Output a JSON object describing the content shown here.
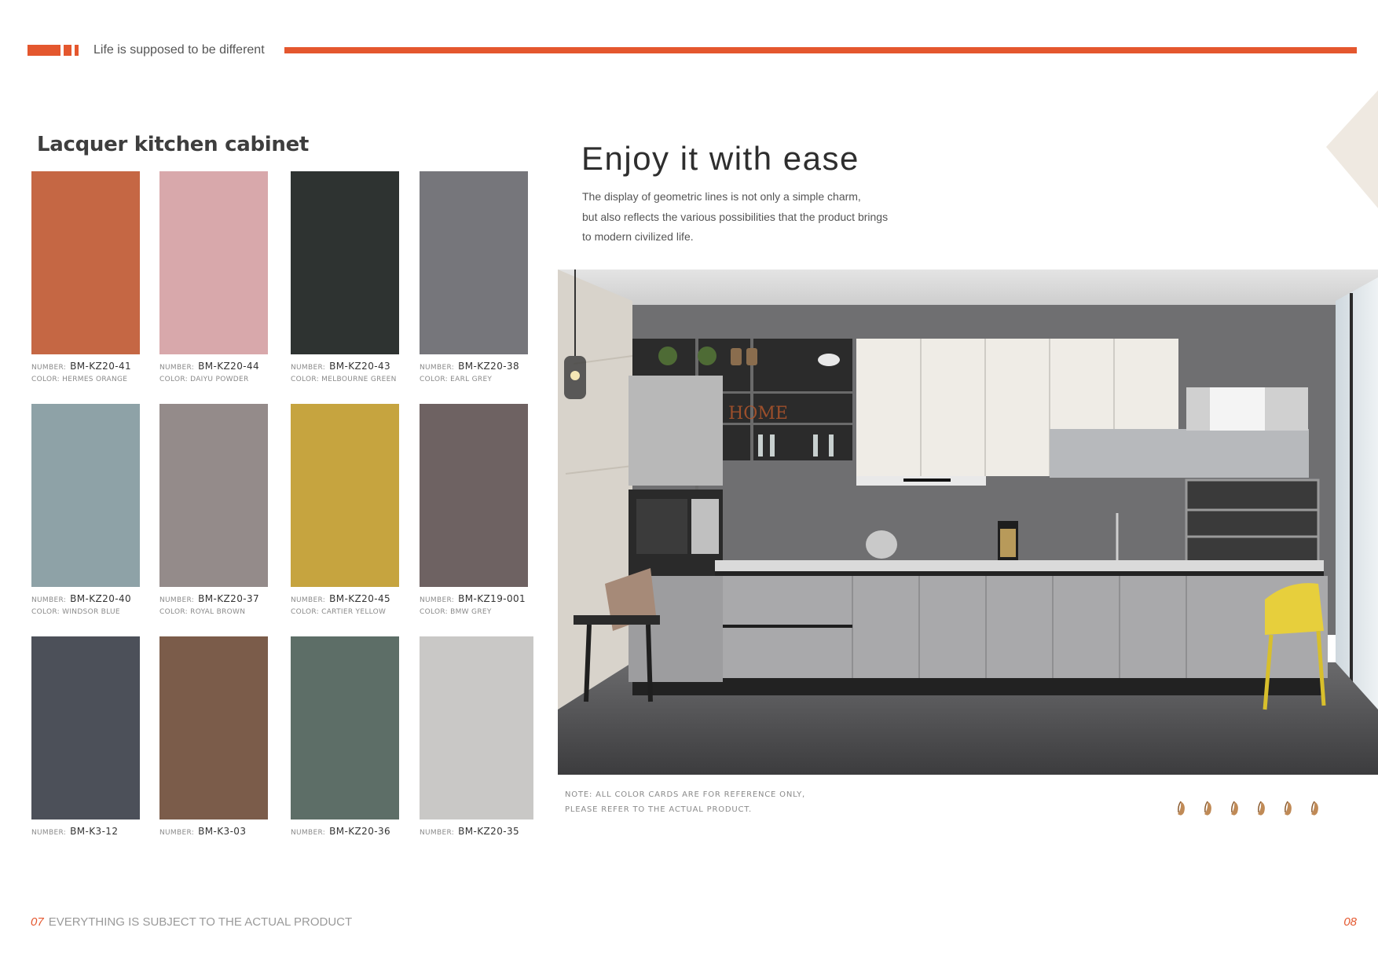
{
  "header": {
    "tagline": "Life is supposed to be different",
    "accent_color": "#e4572e"
  },
  "swatch_section": {
    "title": "Lacquer kitchen cabinet",
    "number_prefix": "NUMBER:",
    "color_prefix": "COLOR:",
    "swatches": [
      {
        "number": "BM-KZ20-41",
        "color_name": "HERMES ORANGE",
        "hex": "#c56744"
      },
      {
        "number": "BM-KZ20-44",
        "color_name": "DAIYU POWDER",
        "hex": "#d8a8ab"
      },
      {
        "number": "BM-KZ20-43",
        "color_name": "MELBOURNE GREEN",
        "hex": "#2e3331"
      },
      {
        "number": "BM-KZ20-38",
        "color_name": "EARL GREY",
        "hex": "#76767b"
      },
      {
        "number": "BM-KZ20-40",
        "color_name": "WINDSOR BLUE",
        "hex": "#8ea2a7"
      },
      {
        "number": "BM-KZ20-37",
        "color_name": "ROYAL BROWN",
        "hex": "#948b8a"
      },
      {
        "number": "BM-KZ20-45",
        "color_name": "CARTIER YELLOW",
        "hex": "#c6a43f"
      },
      {
        "number": "BM-KZ19-001",
        "color_name": "BMW GREY",
        "hex": "#6e6262"
      },
      {
        "number": "BM-K3-12",
        "color_name": "",
        "hex": "#4c5059"
      },
      {
        "number": "BM-K3-03",
        "color_name": "",
        "hex": "#7b5c4a"
      },
      {
        "number": "BM-KZ20-36",
        "color_name": "",
        "hex": "#5d6e67"
      },
      {
        "number": "BM-KZ20-35",
        "color_name": "",
        "hex": "#c9c8c6"
      }
    ]
  },
  "feature": {
    "title": "Enjoy it with ease",
    "description": [
      "The display of geometric lines is not only a simple charm,",
      "but also reflects the various possibilities that the product brings",
      "to modern civilized life."
    ],
    "photo_sign": "HOME"
  },
  "note": {
    "lines": [
      "NOTE: ALL COLOR CARDS ARE FOR REFERENCE ONLY,",
      "PLEASE REFER TO THE ACTUAL PRODUCT."
    ]
  },
  "footer": {
    "left_page": "07",
    "left_text": "EVERYTHING IS SUBJECT TO THE ACTUAL PRODUCT",
    "right_page": "08"
  }
}
